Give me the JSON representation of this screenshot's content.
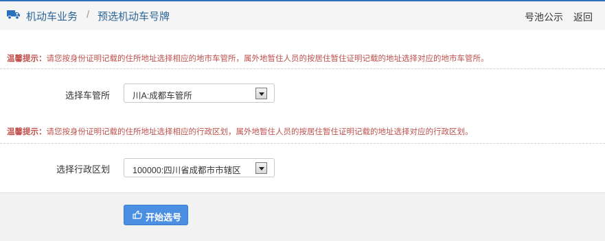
{
  "header": {
    "icon": "truck-icon",
    "breadcrumb": {
      "section": "机动车业务",
      "separator": "/",
      "current": "预选机动车号牌"
    },
    "links": {
      "pool_notice": "号池公示",
      "back": "返回"
    }
  },
  "section1": {
    "tip_prefix": "温馨提示：",
    "tip_text": "请您按身份证明记载的住所地址选择相应的地市车管所，属外地暂住人员的按居住暂住证明记载的地址选择对应的地市车管所。",
    "label": "选择车管所",
    "selected": "川A:成都车管所"
  },
  "section2": {
    "tip_prefix": "温馨提示：",
    "tip_text": "请您按身份证明记载的住所地址选择相应的行政区划，属外地暂住人员的按居住暂住证明记载的地址选择对应的行政区划。",
    "label": "选择行政区划",
    "selected": "100000:四川省成都市市辖区"
  },
  "actions": {
    "start_icon": "hand-pointer-icon",
    "start_label": "开始选号"
  },
  "colors": {
    "accent": "#2a6fbd",
    "tip": "#c0524e",
    "button": "#4a8fe2"
  }
}
